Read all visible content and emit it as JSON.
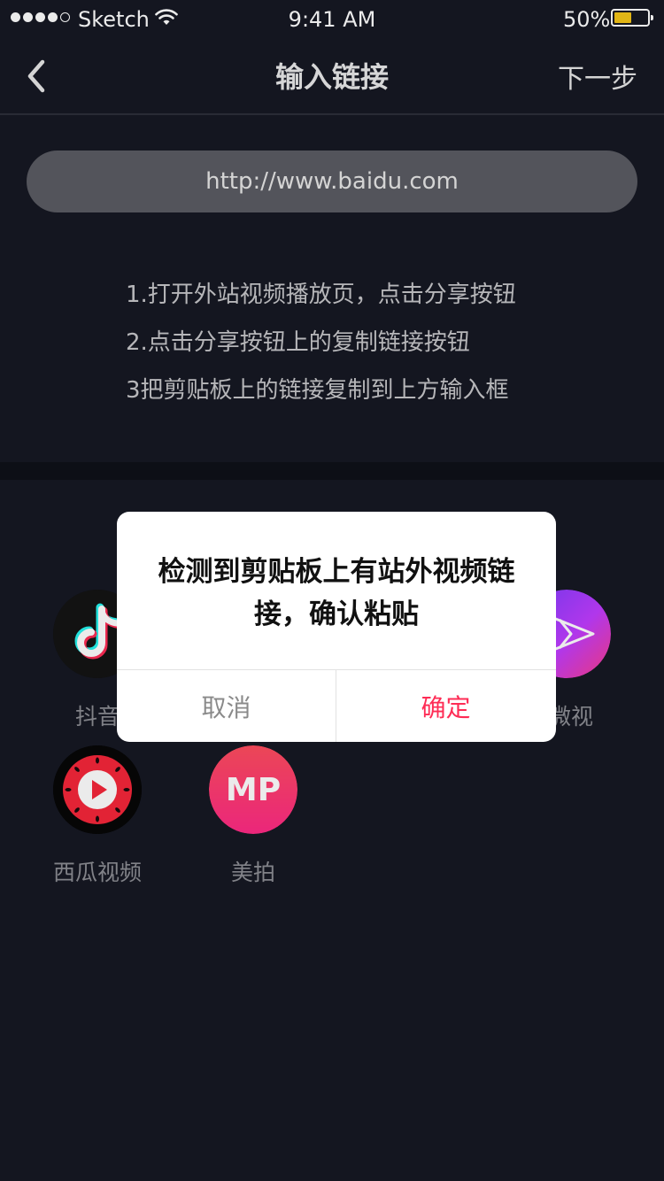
{
  "status_bar": {
    "carrier": "Sketch",
    "time": "9:41 AM",
    "battery_percent": "50%",
    "battery_level": 0.5,
    "battery_color": "#F5C518"
  },
  "nav": {
    "back_icon": "chevron-left-icon",
    "title": "输入链接",
    "next_label": "下一步"
  },
  "url_input": {
    "value": "http://www.baidu.com"
  },
  "instructions": [
    "1.打开外站视频播放页，点击分享按钮",
    "2.点击分享按钮上的复制链接按钮",
    "3把剪贴板上的链接复制到上方输入框"
  ],
  "apps": [
    {
      "label": "抖音",
      "icon": "douyin-icon"
    },
    {
      "label": "微视",
      "icon": "weishi-icon"
    },
    {
      "label": "西瓜视频",
      "icon": "xigua-icon"
    },
    {
      "label": "美拍",
      "icon": "meipai-icon",
      "icon_text": "MP"
    }
  ],
  "dialog": {
    "message": "检测到剪贴板上有站外视频链接，确认粘贴",
    "cancel_label": "取消",
    "confirm_label": "确定",
    "confirm_color": "#FE2C55"
  }
}
